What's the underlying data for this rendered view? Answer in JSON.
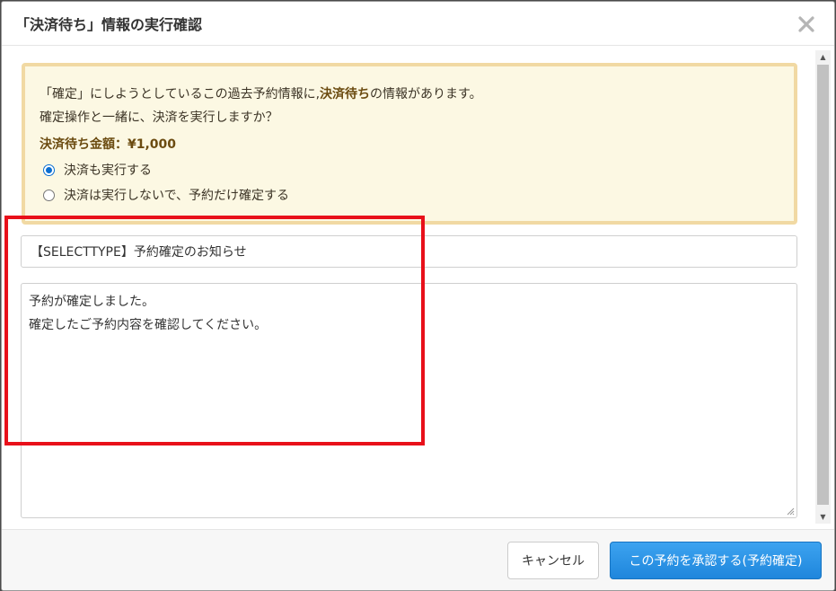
{
  "dialog": {
    "title": "「決済待ち」情報の実行確認",
    "close_icon": "close-icon"
  },
  "notice": {
    "line1_prefix": "「確定」にしようとしているこの過去予約情報に,",
    "line1_bold": "決済待ち",
    "line1_suffix": "の情報があります。",
    "line2": "確定操作と一緒に、決済を実行しますか？",
    "amount_label": "決済待ち金額：¥1,000",
    "options": [
      {
        "label": "決済も実行する",
        "checked": true
      },
      {
        "label": "決済は実行しないで、予約だけ確定する",
        "checked": false
      }
    ]
  },
  "mail": {
    "subject_value": "【SELECTTYPE】予約確定のお知らせ",
    "body_line1": "予約が確定しました。",
    "body_line2": "確定したご予約内容を確認してください。"
  },
  "footer": {
    "cancel_label": "キャンセル",
    "confirm_label": "この予約を承認する(予約確定)"
  },
  "colors": {
    "highlight": "#e8101a",
    "notice_bg": "#fcf8e3",
    "notice_border": "#f1d9a3",
    "primary_button": "#1f86dc"
  }
}
